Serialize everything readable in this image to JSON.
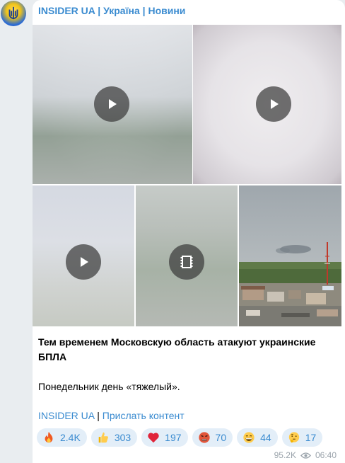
{
  "channel": {
    "name": "INSIDER UA | Україна | Новини",
    "avatar_icon": "ukraine-trident-icon"
  },
  "media": [
    {
      "type": "video",
      "icon": "play-icon"
    },
    {
      "type": "video",
      "icon": "play-icon"
    },
    {
      "type": "video",
      "icon": "play-icon"
    },
    {
      "type": "video",
      "icon": "film-icon"
    },
    {
      "type": "photo",
      "description": "town with power line tower and smoke in sky"
    }
  ],
  "post": {
    "line1": "Тем временем Московскую область атакуют украинские БПЛА",
    "line2": "Понедельник день «тяжелый»."
  },
  "links": {
    "channel": "INSIDER UA",
    "separator": " | ",
    "submit": "Прислать контент"
  },
  "reactions": [
    {
      "emoji": "fire-icon",
      "count": "2.4K"
    },
    {
      "emoji": "thumbs-up-icon",
      "count": "303"
    },
    {
      "emoji": "heart-icon",
      "count": "197"
    },
    {
      "emoji": "angry-face-icon",
      "count": "70"
    },
    {
      "emoji": "grinning-face-icon",
      "count": "44"
    },
    {
      "emoji": "thinking-face-icon",
      "count": "17"
    }
  ],
  "meta": {
    "views": "95.2K",
    "time": "06:40"
  },
  "colors": {
    "accent": "#3a8bd0",
    "reaction_bg": "#e3eef8",
    "page_bg": "#e9edf0"
  }
}
